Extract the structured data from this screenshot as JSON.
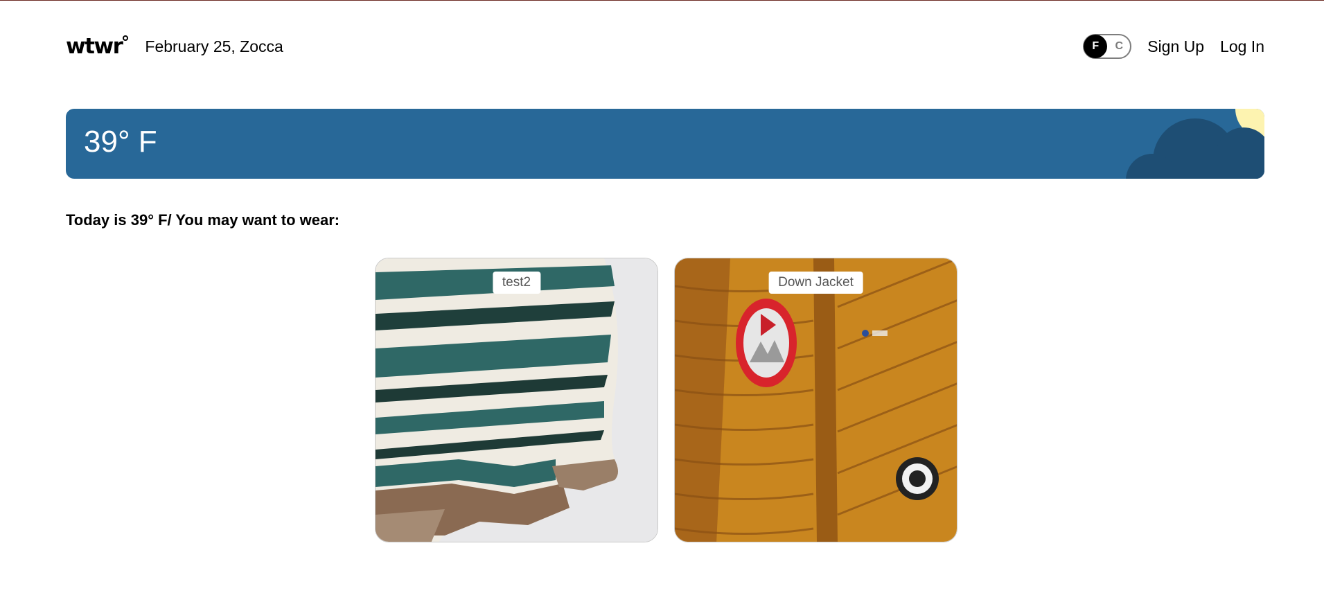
{
  "header": {
    "logo": "wtwr",
    "date_location": "February 25, Zocca",
    "unit_toggle": {
      "f_label": "F",
      "c_label": "C",
      "selected": "F"
    },
    "signup_label": "Sign Up",
    "login_label": "Log In"
  },
  "weather": {
    "temperature": "39° F",
    "condition_icons": [
      "cloud-icon",
      "sun-icon"
    ],
    "colors": {
      "background": "#286898",
      "cloud": "#1e4e74",
      "sun": "#fdf3b0"
    }
  },
  "recommendation": {
    "text": "Today is 39° F/ You may want to wear:"
  },
  "items": [
    {
      "name": "test2",
      "image": "knit-sweater-image"
    },
    {
      "name": "Down Jacket",
      "image": "down-jacket-image"
    }
  ]
}
